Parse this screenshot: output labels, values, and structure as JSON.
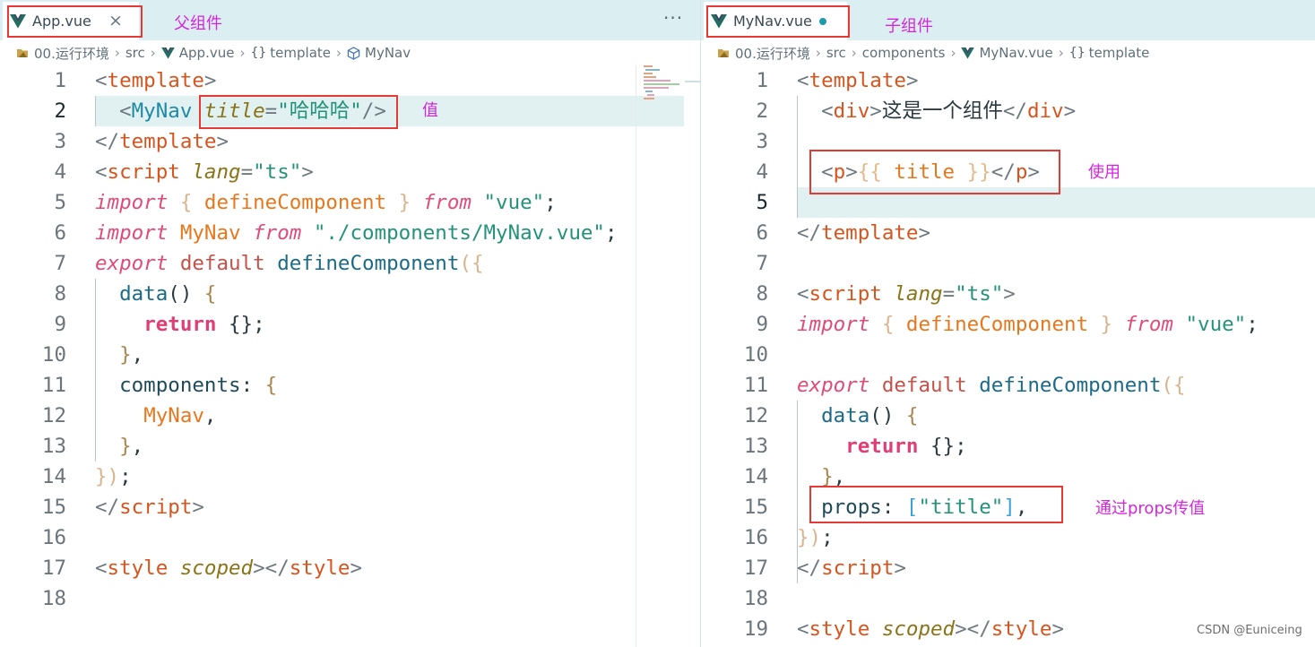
{
  "left": {
    "tab": {
      "icon": "vue-logo-icon",
      "label": "App.vue",
      "close": "×"
    },
    "annotation_tab": "父组件",
    "more": "···",
    "breadcrumb": [
      "00.运行环境",
      "src",
      "App.vue",
      "template",
      "MyNav"
    ],
    "annotation_value": "值",
    "lines": [
      [
        [
          "<",
          "p"
        ],
        [
          "template",
          "t"
        ],
        [
          ">",
          "p"
        ]
      ],
      [
        [
          "  "
        ],
        [
          "<",
          "p"
        ],
        [
          "MyNav",
          "c"
        ],
        [
          " "
        ],
        [
          "title",
          "a"
        ],
        [
          "=",
          "p"
        ],
        [
          "\"哈哈哈\"",
          "s"
        ],
        [
          "/>",
          "p"
        ]
      ],
      [
        [
          "</",
          "p"
        ],
        [
          "template",
          "t"
        ],
        [
          ">",
          "p"
        ]
      ],
      [
        [
          "<",
          "p"
        ],
        [
          "script",
          "t"
        ],
        [
          " "
        ],
        [
          "lang",
          "a"
        ],
        [
          "=",
          "p"
        ],
        [
          "\"ts\"",
          "s"
        ],
        [
          ">",
          "p"
        ]
      ],
      [
        [
          "import",
          "k"
        ],
        [
          " "
        ],
        [
          "{",
          "b1"
        ],
        [
          " "
        ],
        [
          "defineComponent",
          "v"
        ],
        [
          " "
        ],
        [
          "}",
          "b1"
        ],
        [
          " "
        ],
        [
          "from",
          "k"
        ],
        [
          " "
        ],
        [
          "\"vue\"",
          "s"
        ],
        [
          ";",
          "x"
        ]
      ],
      [
        [
          "import",
          "k"
        ],
        [
          " "
        ],
        [
          "MyNav",
          "v"
        ],
        [
          " "
        ],
        [
          "from",
          "k"
        ],
        [
          " "
        ],
        [
          "\"./components/MyNav.vue\"",
          "s"
        ],
        [
          ";",
          "x"
        ]
      ],
      [
        [
          "export",
          "k"
        ],
        [
          " "
        ],
        [
          "default",
          "d"
        ],
        [
          " "
        ],
        [
          "defineComponent",
          "f"
        ],
        [
          "(",
          "b1"
        ],
        [
          "{",
          "b1"
        ]
      ],
      [
        [
          "  "
        ],
        [
          "data",
          "f"
        ],
        [
          "()",
          "x"
        ],
        [
          " "
        ],
        [
          "{",
          "b2"
        ]
      ],
      [
        [
          "    "
        ],
        [
          "return",
          "kb"
        ],
        [
          " "
        ],
        [
          "{}",
          "x"
        ],
        [
          ";",
          "x"
        ]
      ],
      [
        [
          "  "
        ],
        [
          "}",
          "b2"
        ],
        [
          ",",
          "x"
        ]
      ],
      [
        [
          "  "
        ],
        [
          "components",
          "r"
        ],
        [
          ": ",
          "x"
        ],
        [
          "{",
          "b2"
        ]
      ],
      [
        [
          "    "
        ],
        [
          "MyNav",
          "v"
        ],
        [
          ",",
          "x"
        ]
      ],
      [
        [
          "  "
        ],
        [
          "}",
          "b2"
        ],
        [
          ",",
          "x"
        ]
      ],
      [
        [
          "}",
          "b1"
        ],
        [
          ")",
          "b1"
        ],
        [
          ";",
          "x"
        ]
      ],
      [
        [
          "</",
          "p"
        ],
        [
          "script",
          "t"
        ],
        [
          ">",
          "p"
        ]
      ],
      [],
      [
        [
          "<",
          "p"
        ],
        [
          "style",
          "t"
        ],
        [
          " "
        ],
        [
          "scoped",
          "a"
        ],
        [
          "></",
          "p"
        ],
        [
          "style",
          "t"
        ],
        [
          ">",
          "p"
        ]
      ],
      []
    ]
  },
  "right": {
    "tab": {
      "icon": "vue-logo-icon",
      "label": "MyNav.vue"
    },
    "annotation_tab": "子组件",
    "breadcrumb": [
      "00.运行环境",
      "src",
      "components",
      "MyNav.vue",
      "template"
    ],
    "annotation_use": "使用",
    "annotation_props": "通过props传值",
    "lines": [
      [
        [
          "<",
          "p"
        ],
        [
          "template",
          "t"
        ],
        [
          ">",
          "p"
        ]
      ],
      [
        [
          "  "
        ],
        [
          "<",
          "p"
        ],
        [
          "div",
          "t"
        ],
        [
          ">",
          "p"
        ],
        [
          "这是一个组件",
          "x"
        ],
        [
          "</",
          "p"
        ],
        [
          "div",
          "t"
        ],
        [
          ">",
          "p"
        ]
      ],
      [],
      [
        [
          "  "
        ],
        [
          "<",
          "p"
        ],
        [
          "p",
          "t"
        ],
        [
          ">",
          "p"
        ],
        [
          "{{",
          "m"
        ],
        [
          " "
        ],
        [
          "title",
          "v"
        ],
        [
          " "
        ],
        [
          "}}",
          "m"
        ],
        [
          "</",
          "p"
        ],
        [
          "p",
          "t"
        ],
        [
          ">",
          "p"
        ]
      ],
      [],
      [
        [
          "</",
          "p"
        ],
        [
          "template",
          "t"
        ],
        [
          ">",
          "p"
        ]
      ],
      [],
      [
        [
          "<",
          "p"
        ],
        [
          "script",
          "t"
        ],
        [
          " "
        ],
        [
          "lang",
          "a"
        ],
        [
          "=",
          "p"
        ],
        [
          "\"ts\"",
          "s"
        ],
        [
          ">",
          "p"
        ]
      ],
      [
        [
          "import",
          "k"
        ],
        [
          " "
        ],
        [
          "{",
          "b1"
        ],
        [
          " "
        ],
        [
          "defineComponent",
          "v"
        ],
        [
          " "
        ],
        [
          "}",
          "b1"
        ],
        [
          " "
        ],
        [
          "from",
          "k"
        ],
        [
          " "
        ],
        [
          "\"vue\"",
          "s"
        ],
        [
          ";",
          "x"
        ]
      ],
      [],
      [
        [
          "export",
          "k"
        ],
        [
          " "
        ],
        [
          "default",
          "d"
        ],
        [
          " "
        ],
        [
          "defineComponent",
          "f"
        ],
        [
          "(",
          "b1"
        ],
        [
          "{",
          "b1"
        ]
      ],
      [
        [
          "  "
        ],
        [
          "data",
          "f"
        ],
        [
          "()",
          "x"
        ],
        [
          " "
        ],
        [
          "{",
          "b2"
        ]
      ],
      [
        [
          "    "
        ],
        [
          "return",
          "kb"
        ],
        [
          " "
        ],
        [
          "{}",
          "x"
        ],
        [
          ";",
          "x"
        ]
      ],
      [
        [
          "  "
        ],
        [
          "}",
          "b2"
        ],
        [
          ",",
          "x"
        ]
      ],
      [
        [
          "  "
        ],
        [
          "props",
          "r"
        ],
        [
          ": ",
          "x"
        ],
        [
          "[",
          "b3"
        ],
        [
          "\"title\"",
          "s"
        ],
        [
          "]",
          "b3"
        ],
        [
          ",",
          "x"
        ]
      ],
      [
        [
          "}",
          "b1"
        ],
        [
          ")",
          "b1"
        ],
        [
          ";",
          "x"
        ]
      ],
      [
        [
          "</",
          "p"
        ],
        [
          "script",
          "t"
        ],
        [
          ">",
          "p"
        ]
      ],
      [],
      [
        [
          "<",
          "p"
        ],
        [
          "style",
          "t"
        ],
        [
          " "
        ],
        [
          "scoped",
          "a"
        ],
        [
          "></",
          "p"
        ],
        [
          "style",
          "t"
        ],
        [
          ">",
          "p"
        ]
      ]
    ]
  },
  "watermark": "CSDN @Euniceing"
}
